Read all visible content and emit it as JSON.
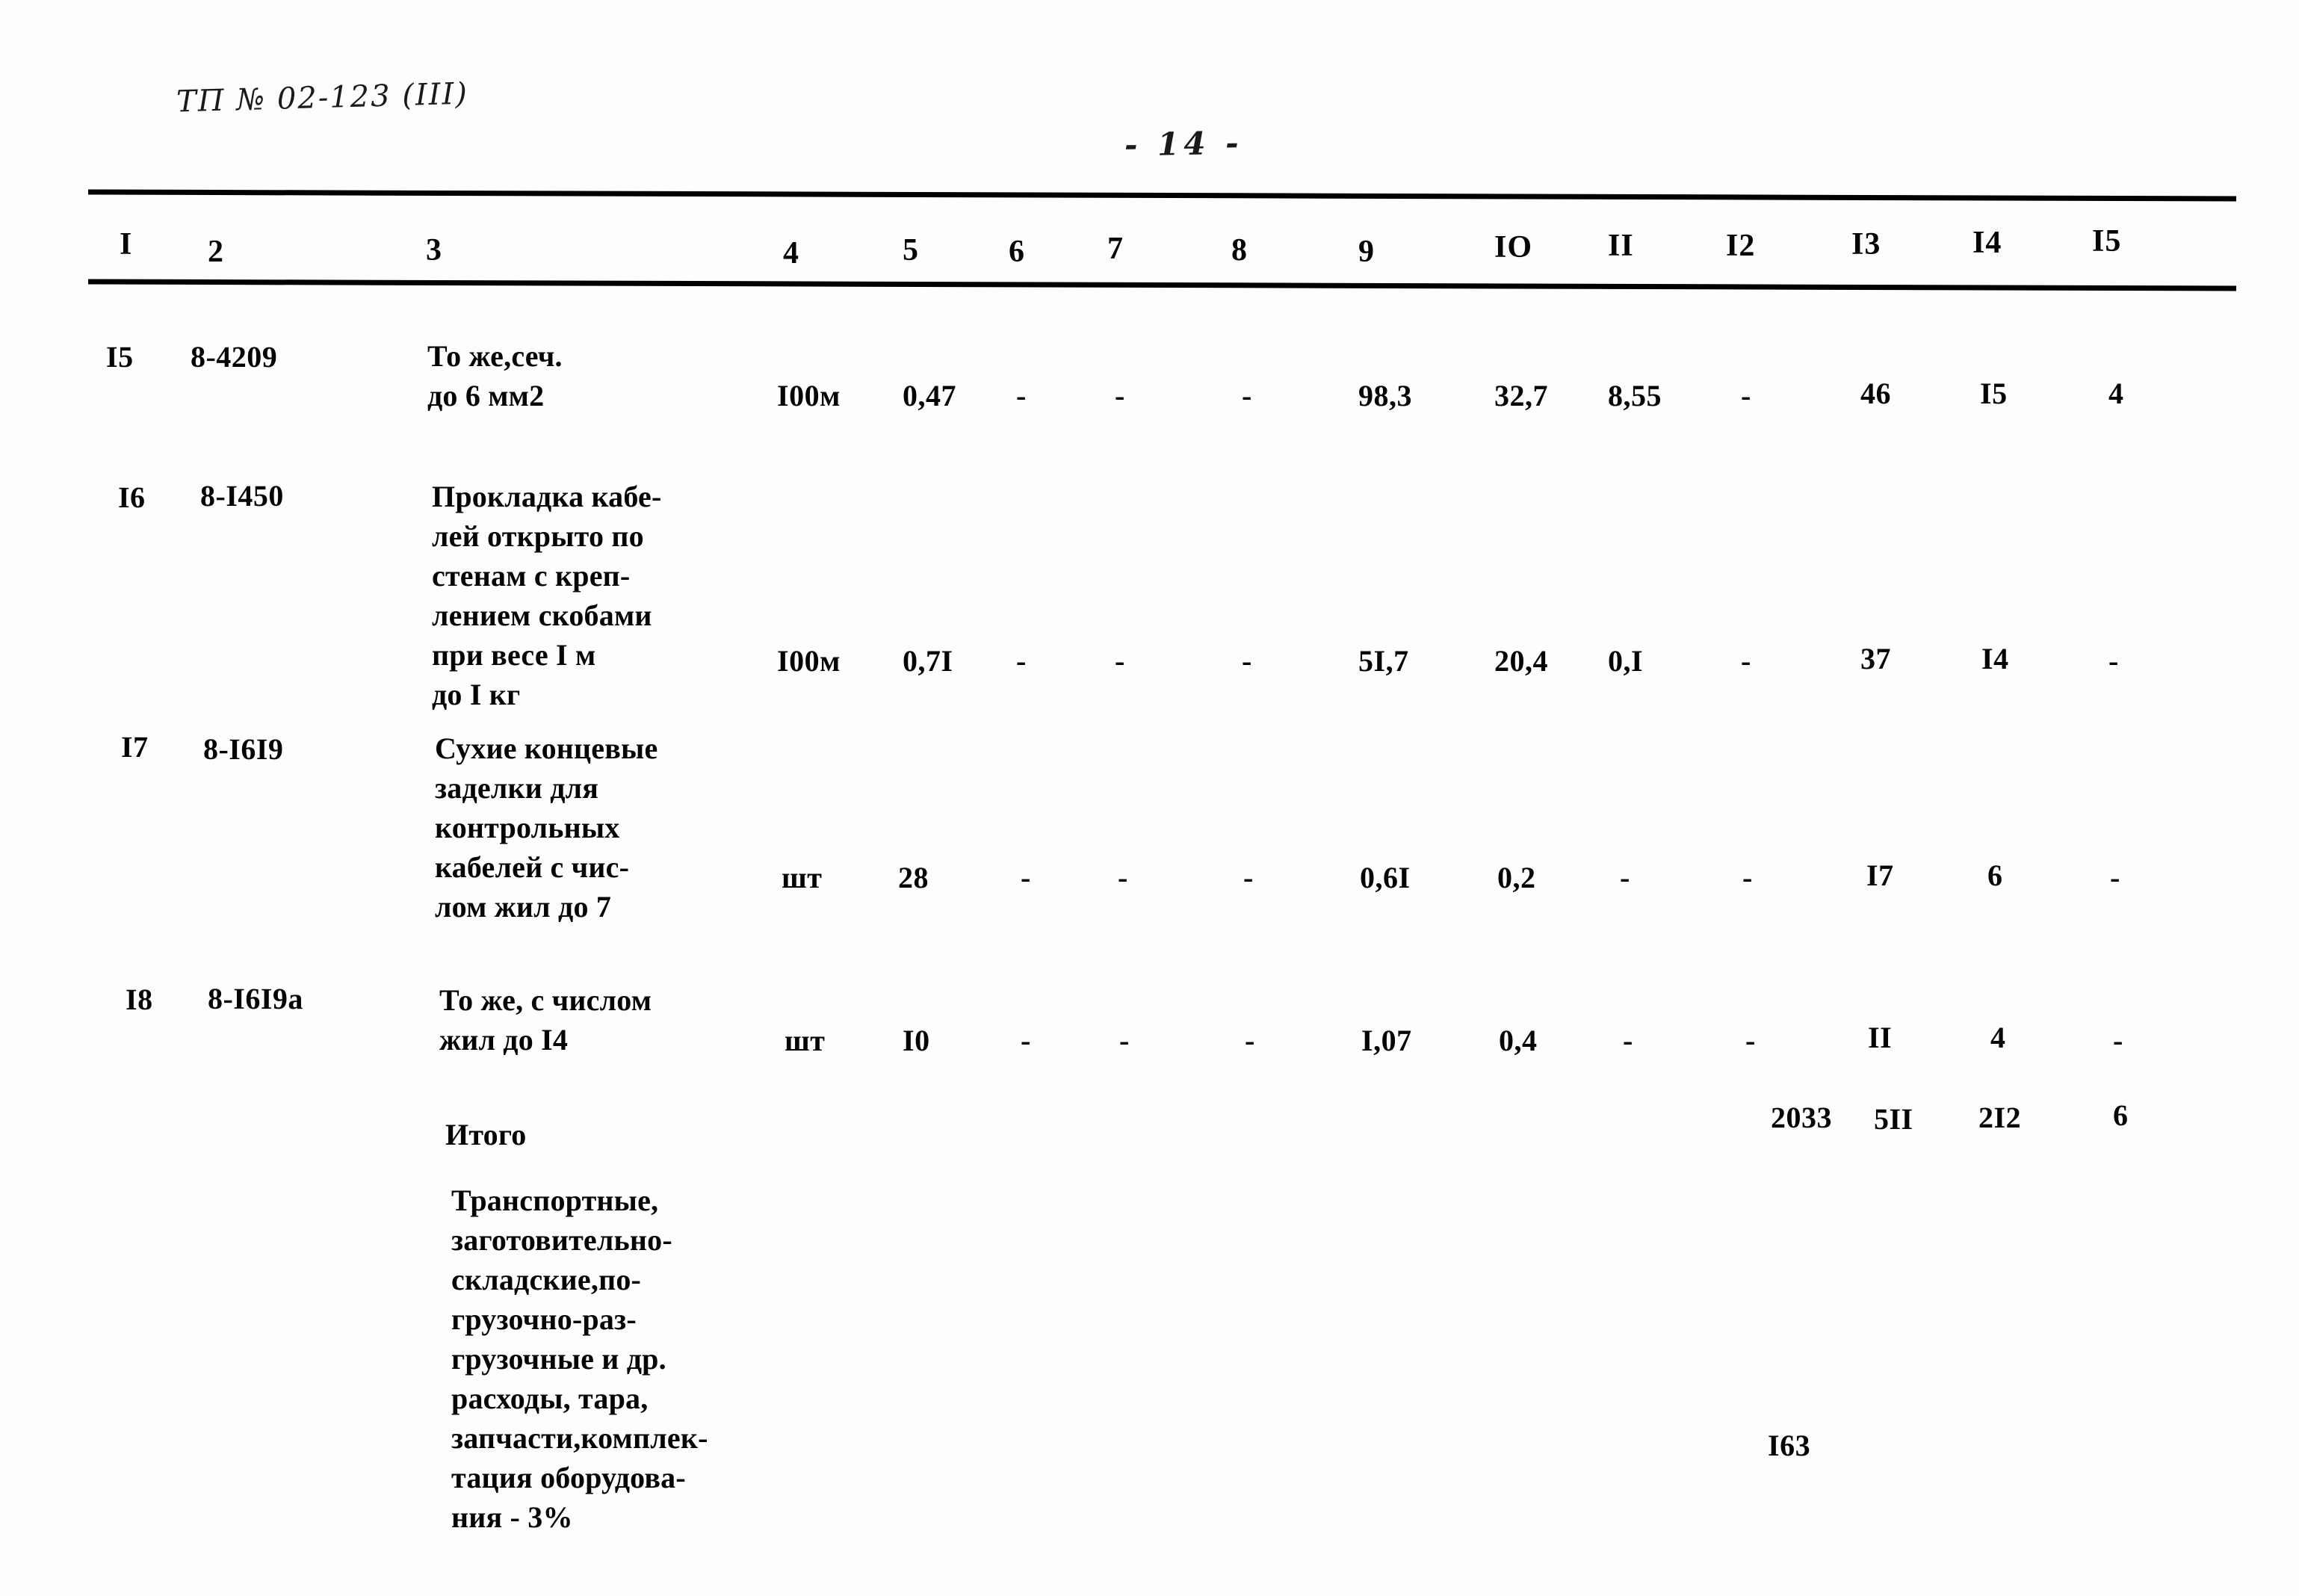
{
  "annotations": {
    "doc_code": "ТП  № 02-123  (III)",
    "page_number": "- 14 -"
  },
  "table": {
    "column_headers": [
      "I",
      "2",
      "3",
      "4",
      "5",
      "6",
      "7",
      "8",
      "9",
      "IO",
      "II",
      "I2",
      "I3",
      "I4",
      "I5"
    ],
    "rows": [
      {
        "no": "I5",
        "code": "8-4209",
        "description": "То же,сеч.\nдо 6 мм2",
        "unit": "I00м",
        "qty": "0,47",
        "c6": "-",
        "c7": "-",
        "c8": "-",
        "c9": "98,3",
        "c10": "32,7",
        "c11": "8,55",
        "c12": "-",
        "c13": "46",
        "c14": "I5",
        "c15": "4"
      },
      {
        "no": "I6",
        "code": "8-I450",
        "description": "Прокладка кабе-\nлей открыто по\nстенам с креп-\nлением скобами\nпри весе I м\nдо I кг",
        "unit": "I00м",
        "qty": "0,7I",
        "c6": "-",
        "c7": "-",
        "c8": "-",
        "c9": "5I,7",
        "c10": "20,4",
        "c11": "0,I",
        "c12": "-",
        "c13": "37",
        "c14": "I4",
        "c15": "-"
      },
      {
        "no": "I7",
        "code": "8-I6I9",
        "description": "Сухие концевые\nзаделки для\nконтрольных\nкабелей с чис-\nлом жил до 7",
        "unit": "шт",
        "qty": "28",
        "c6": "-",
        "c7": "-",
        "c8": "-",
        "c9": "0,6I",
        "c10": "0,2",
        "c11": "-",
        "c12": "-",
        "c13": "I7",
        "c14": "6",
        "c15": "-"
      },
      {
        "no": "I8",
        "code": "8-I6I9а",
        "description": "То же, с числом\nжил до I4",
        "unit": "шт",
        "qty": "I0",
        "c6": "-",
        "c7": "-",
        "c8": "-",
        "c9": "I,07",
        "c10": "0,4",
        "c11": "-",
        "c12": "-",
        "c13": "II",
        "c14": "4",
        "c15": "-"
      }
    ],
    "total_row": {
      "label": "Итого",
      "c12": "2033",
      "c13": "5II",
      "c14": "2I2",
      "c15": "6"
    },
    "overhead_row": {
      "description": "Транспортные,\nзаготовительно-\nскладские,по-\nгрузочно-раз-\nгрузочные и др.\nрасходы, тара,\nзапчасти,комплек-\nтация оборудова-\nния - 3%",
      "value": "I63"
    }
  }
}
